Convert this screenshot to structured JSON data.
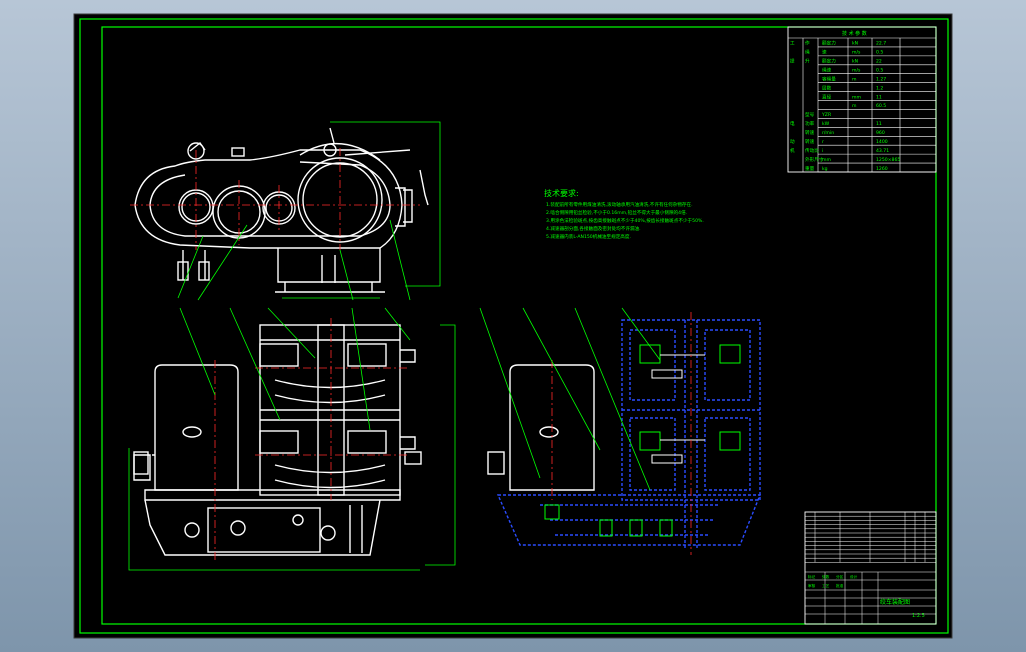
{
  "drawing": {
    "colors": {
      "background": "#000000",
      "border": "#00ff00",
      "outline": "#ffffff",
      "centerline": "#ff2a2a",
      "leader": "#00ff00",
      "section": "#2a4cff",
      "text": "#00ff00"
    },
    "tech_notes": {
      "title": "技术要求:",
      "lines": [
        "1.装配前所有零件用煤油清洗,滚动轴承用汽油清洗,不许有任何杂物存在.",
        "2.啮合侧隙用铅丝检验,不小于0.16mm,铅丝不得大于最小侧隙的4倍.",
        "3.用涂色法检验斑点,按齿高接触斑点不少于40%,按齿长接触斑点不少于50%.",
        "4.减速器剖分面,各接触面及密封处均不许漏油.",
        "5.减速器内装L-AN150机械油至规定高度."
      ]
    },
    "spec_table": {
      "header": "技 术 参 数",
      "rows": [
        [
          "工",
          "作",
          "额定力",
          "kN",
          "22.7"
        ],
        [
          "",
          "绳",
          "速",
          "m/s",
          "0.5"
        ],
        [
          "提",
          "升",
          "额定力",
          "kN",
          "22"
        ],
        [
          "",
          "",
          "绳速",
          "m/s",
          "0.5"
        ],
        [
          "",
          "",
          "容绳量",
          "m",
          "1.27"
        ],
        [
          "",
          "",
          "层数",
          "",
          "1.2"
        ],
        [
          "",
          "",
          "直径",
          "mm",
          "11"
        ],
        [
          "",
          "",
          "",
          "m",
          "60.5"
        ],
        [
          "",
          "型号",
          "YZR",
          "",
          ""
        ],
        [
          "电",
          "功率",
          "kW",
          "",
          "11"
        ],
        [
          "",
          "转速",
          "r/min",
          "",
          "960"
        ],
        [
          "动",
          "转速",
          "r",
          "",
          "1400"
        ],
        [
          "机",
          "传动比",
          "i",
          "",
          "43.71"
        ],
        [
          "",
          "外形尺寸",
          "mm",
          "",
          "1250×865"
        ],
        [
          "",
          "重量",
          "kg",
          "",
          "1260"
        ]
      ]
    },
    "title_block": {
      "parts_rows": 12,
      "labels": [
        "标记",
        "处数",
        "分区",
        "设计",
        "审核",
        "工艺",
        "批准"
      ],
      "drawing_name": "绞车装配图",
      "sheet": "1:2.5"
    }
  }
}
